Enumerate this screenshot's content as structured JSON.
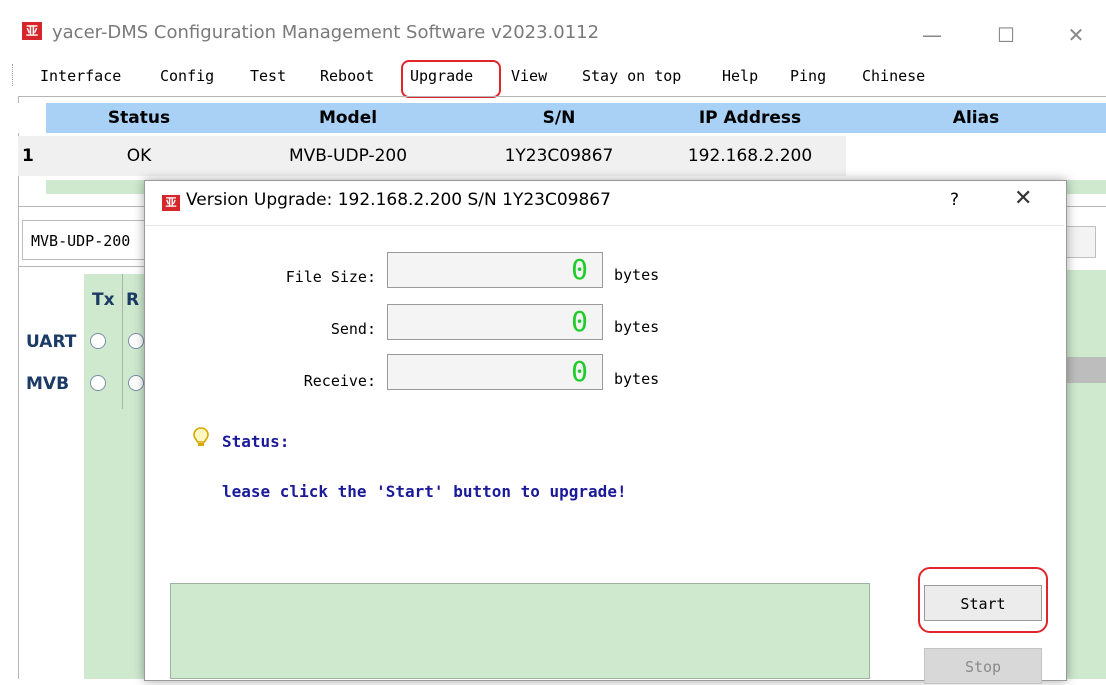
{
  "app": {
    "logo_text": "亚",
    "title": "yacer-DMS Configuration Management Software v2023.0112",
    "minimize": "—",
    "maximize": "☐",
    "close": "✕"
  },
  "menu": {
    "items": [
      "Interface",
      "Config",
      "Test",
      "Reboot",
      "Upgrade",
      "View",
      "Stay on top",
      "Help",
      "Ping",
      "Chinese"
    ]
  },
  "table": {
    "headers": [
      "Status",
      "Model",
      "S/N",
      "IP Address",
      "Alias"
    ],
    "rows": [
      {
        "num": "1",
        "status": "OK",
        "model": "MVB-UDP-200",
        "sn": "1Y23C09867",
        "ip": "192.168.2.200",
        "alias": ""
      }
    ]
  },
  "side_panel": {
    "device_tab": "MVB-UDP-200",
    "col_tx": "Tx",
    "col_rx": "R",
    "rows": [
      "UART",
      "MVB"
    ]
  },
  "dialog": {
    "logo_text": "亚",
    "title": "Version Upgrade: 192.168.2.200  S/N 1Y23C09867",
    "help": "?",
    "close": "✕",
    "fields": [
      {
        "label": "File Size:",
        "value": "0",
        "unit": "bytes"
      },
      {
        "label": "Send:",
        "value": "0",
        "unit": "bytes"
      },
      {
        "label": "Receive:",
        "value": "0",
        "unit": "bytes"
      }
    ],
    "status_label": "Status:",
    "status_message": "lease click the 'Start' button to upgrade!",
    "start_label": "Start",
    "stop_label": "Stop"
  },
  "colors": {
    "header_blue": "#a9d0f5",
    "panel_green": "#cfe9cf",
    "highlight_red": "#e0262b",
    "lcd_green": "#1fcc2a",
    "status_text": "#1a1a9a"
  }
}
